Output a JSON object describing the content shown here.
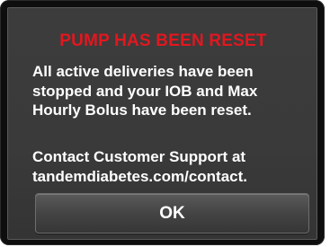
{
  "dialog": {
    "title": "PUMP HAS BEEN RESET",
    "message_lines": [
      "All active deliveries have been",
      "stopped and your IOB and Max",
      "Hourly Bolus have been reset."
    ],
    "contact_lines": [
      "Contact Customer Support at",
      "tandemdiabetes.com/contact."
    ],
    "ok_label": "OK"
  },
  "colors": {
    "title": "#e2171f",
    "text": "#ffffff",
    "screen_background": "#3a3a3a",
    "bezel": "#0e0e0e"
  }
}
